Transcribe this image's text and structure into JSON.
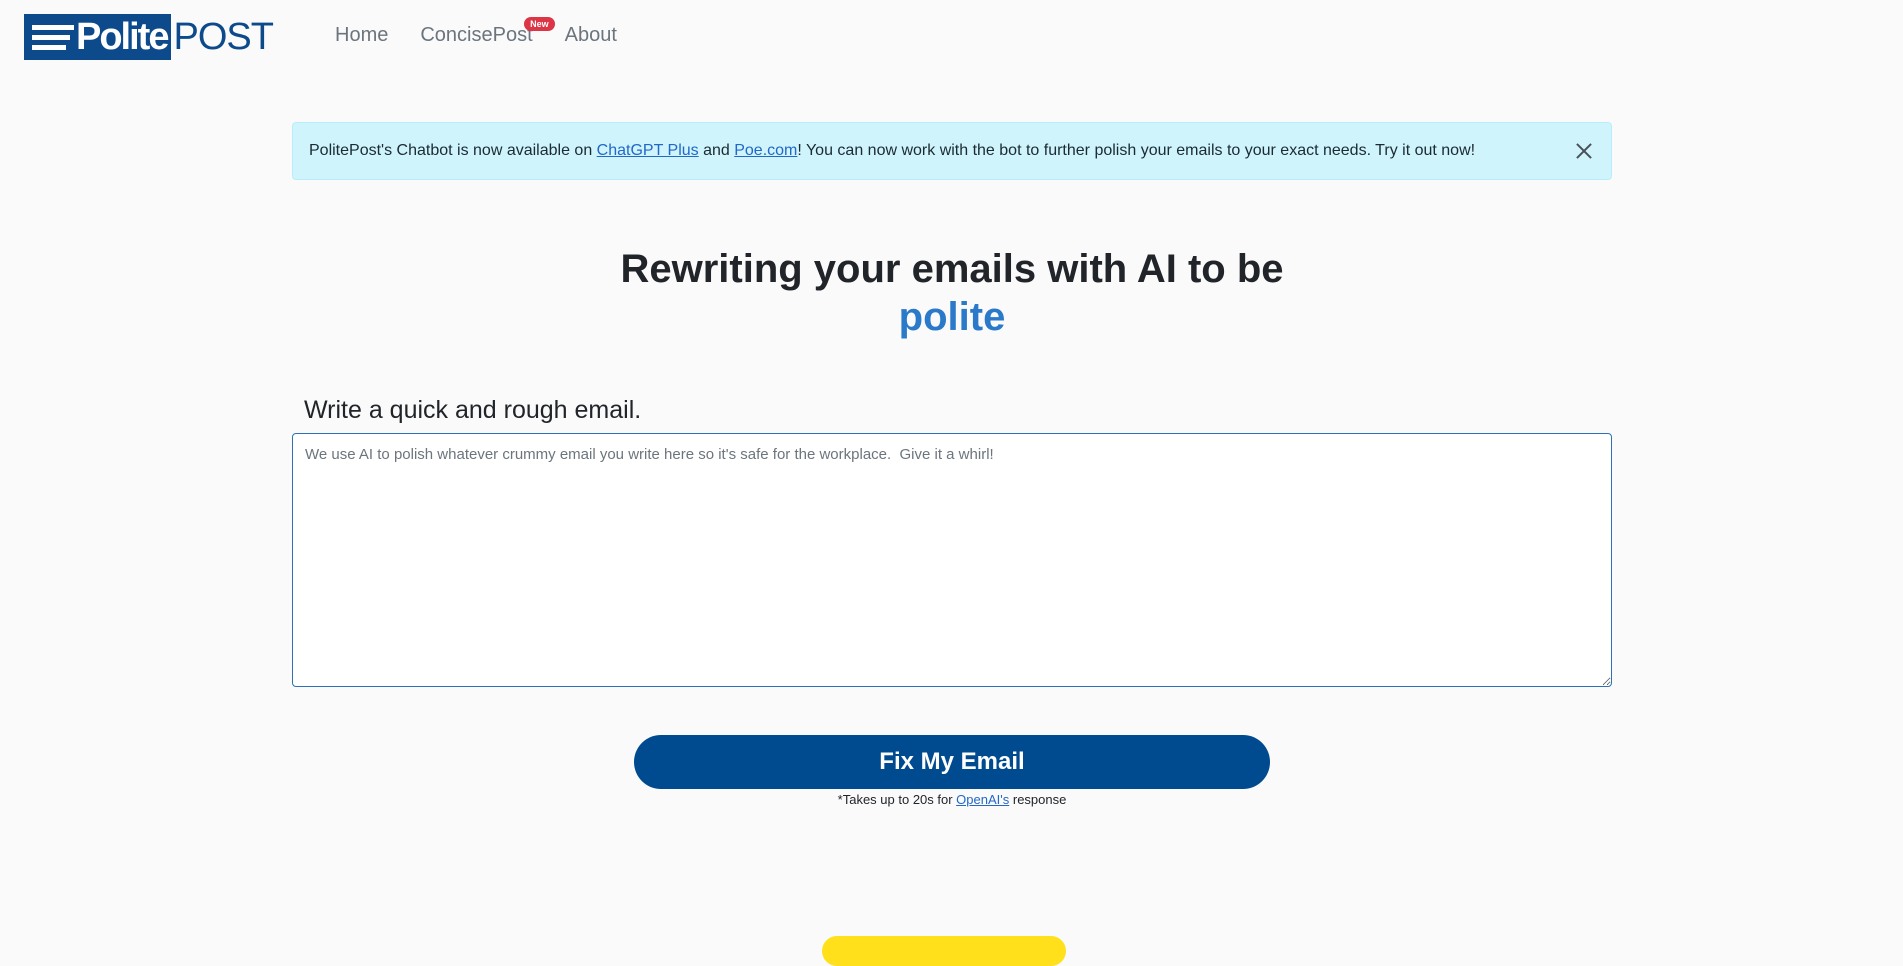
{
  "brand": {
    "logo_polite": "Polite",
    "logo_post": "POST",
    "primary_color": "#0c4a8c",
    "accent_color": "#2a7ac9"
  },
  "nav": {
    "items": [
      {
        "label": "Home"
      },
      {
        "label": "ConcisePost",
        "badge": "New"
      },
      {
        "label": "About"
      }
    ]
  },
  "alert": {
    "text_before": "PolitePost's Chatbot is now available on ",
    "link1": "ChatGPT Plus",
    "text_mid": " and ",
    "link2": "Poe.com",
    "text_after": "! You can now work with the bot to further polish your emails to your exact needs. Try it out now!",
    "close_icon": "close-icon"
  },
  "hero": {
    "title": "Rewriting your emails with AI to be",
    "word": "polite"
  },
  "form": {
    "label": "Write a quick and rough email.",
    "placeholder": "We use AI to polish whatever crummy email you write here so it's safe for the workplace.  Give it a whirl!",
    "value": "",
    "button_label": "Fix My Email",
    "note_before": "*Takes up to 20s for ",
    "note_link": "OpenAI's",
    "note_after": " response"
  }
}
